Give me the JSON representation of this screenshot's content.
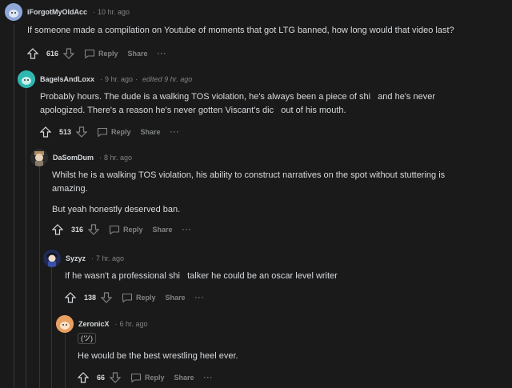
{
  "comments": [
    {
      "user": "iForgotMyOldAcc",
      "time": "10 hr. ago",
      "edited": "",
      "body": [
        "If someone made a compilation on Youtube of moments that got LTG banned, how long would that video last?"
      ],
      "score": "616",
      "reply": "Reply",
      "share": "Share",
      "more": "···",
      "avatar_color": "#8fa7d8"
    },
    {
      "user": "BagelsAndLoxx",
      "time": "9 hr. ago",
      "edited": "edited 9 hr. ago",
      "body": [
        "Probably hours. The dude is a walking TOS violation, he's always been a piece of shi   and he's never apologized. There's a reason he's never gotten Viscant's dic   out of his mouth."
      ],
      "score": "513",
      "reply": "Reply",
      "share": "Share",
      "more": "···",
      "avatar_color": "#2fb8b0"
    },
    {
      "user": "DaSomDum",
      "time": "8 hr. ago",
      "edited": "",
      "body": [
        "Whilst he is a walking TOS violation, his ability to construct narratives on the spot without stuttering is amazing.",
        "But yeah honestly deserved ban."
      ],
      "score": "316",
      "reply": "Reply",
      "share": "Share",
      "more": "···",
      "avatar_color": "#9a8a7a"
    },
    {
      "user": "Syzyz",
      "time": "7 hr. ago",
      "edited": "",
      "body": [
        "If he wasn't a professional shi   talker he could be an oscar level writer"
      ],
      "score": "138",
      "reply": "Reply",
      "share": "Share",
      "more": "···",
      "avatar_color": "#3a4fa8"
    },
    {
      "user": "ZeronicX",
      "time": "6 hr. ago",
      "edited": "",
      "emote": "(ツ)",
      "body": [
        "He would be the best wrestling heel ever."
      ],
      "score": "66",
      "reply": "Reply",
      "share": "Share",
      "more": "···",
      "avatar_color": "#e8a060"
    }
  ]
}
